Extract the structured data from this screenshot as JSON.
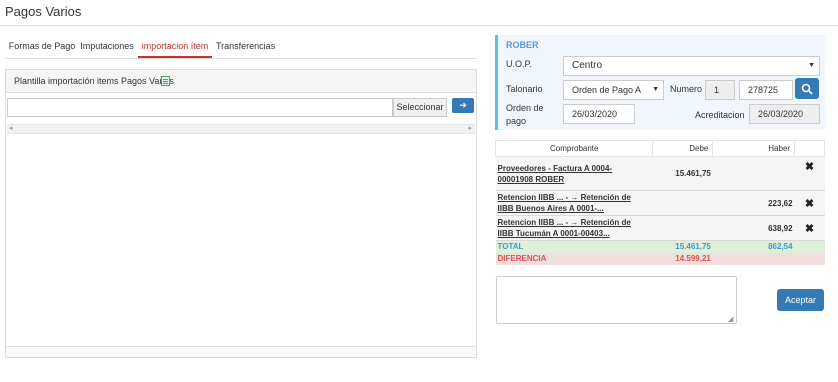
{
  "page": {
    "title": "Pagos Varios"
  },
  "tabs": [
    {
      "label": "Formas de Pago",
      "active": false
    },
    {
      "label": "Imputaciones",
      "active": false
    },
    {
      "label": "importacion ítem",
      "active": true
    },
    {
      "label": "Transferencias",
      "active": false
    }
  ],
  "plantilla": {
    "title": "Plantilla importación items Pagos Varios",
    "file_value": "",
    "select_label": "Seleccionar",
    "arrow_icon": "arrow-right-icon",
    "excel_icon": "excel-icon"
  },
  "header": {
    "name": "ROBER",
    "uop_label": "U.O.P.",
    "uop_value": "Centro",
    "talonario_label": "Talonario",
    "talonario_value": "Orden de Pago A",
    "numero_label": "Numero",
    "numero_serie": "1",
    "numero_value": "278725",
    "orden_label_1": "Orden de",
    "orden_label_2": "pago",
    "orden_value": "26/03/2020",
    "acreditacion_label": "Acreditacion",
    "acreditacion_value": "26/03/2020",
    "search_icon": "search-icon"
  },
  "grid": {
    "columns": [
      "Comprobante",
      "Debe",
      "Haber"
    ],
    "rows": [
      {
        "line1": "Proveedores - Factura A 0004-",
        "line2": "00001908 ROBER",
        "debe": "15.461,75",
        "haber": "",
        "icon": "close-icon"
      },
      {
        "line1": "Retencion IIBB ... - → Retención de",
        "line2": "IIBB Buenos Aires A 0001-...",
        "debe": "",
        "haber": "223,62",
        "icon": "close-icon"
      },
      {
        "line1": "Retencion IIBB ... - → Retención de",
        "line2": "IIBB Tucumán A 0001-00403...",
        "debe": "",
        "haber": "638,92",
        "icon": "close-icon"
      }
    ],
    "total": {
      "label": "TOTAL",
      "debe": "15.461,75",
      "haber": "862,54"
    },
    "diferencia": {
      "label": "DIFERENCIA",
      "debe": "14.599,21",
      "haber": ""
    }
  },
  "observaciones": {
    "value": ""
  },
  "actions": {
    "aceptar_label": "Aceptar"
  },
  "colors": {
    "primary": "#337ab7",
    "active_tab": "#c9302c",
    "total_bg": "#dff0d8",
    "diff_bg": "#f2dede",
    "header_accent": "#5bc0de"
  }
}
